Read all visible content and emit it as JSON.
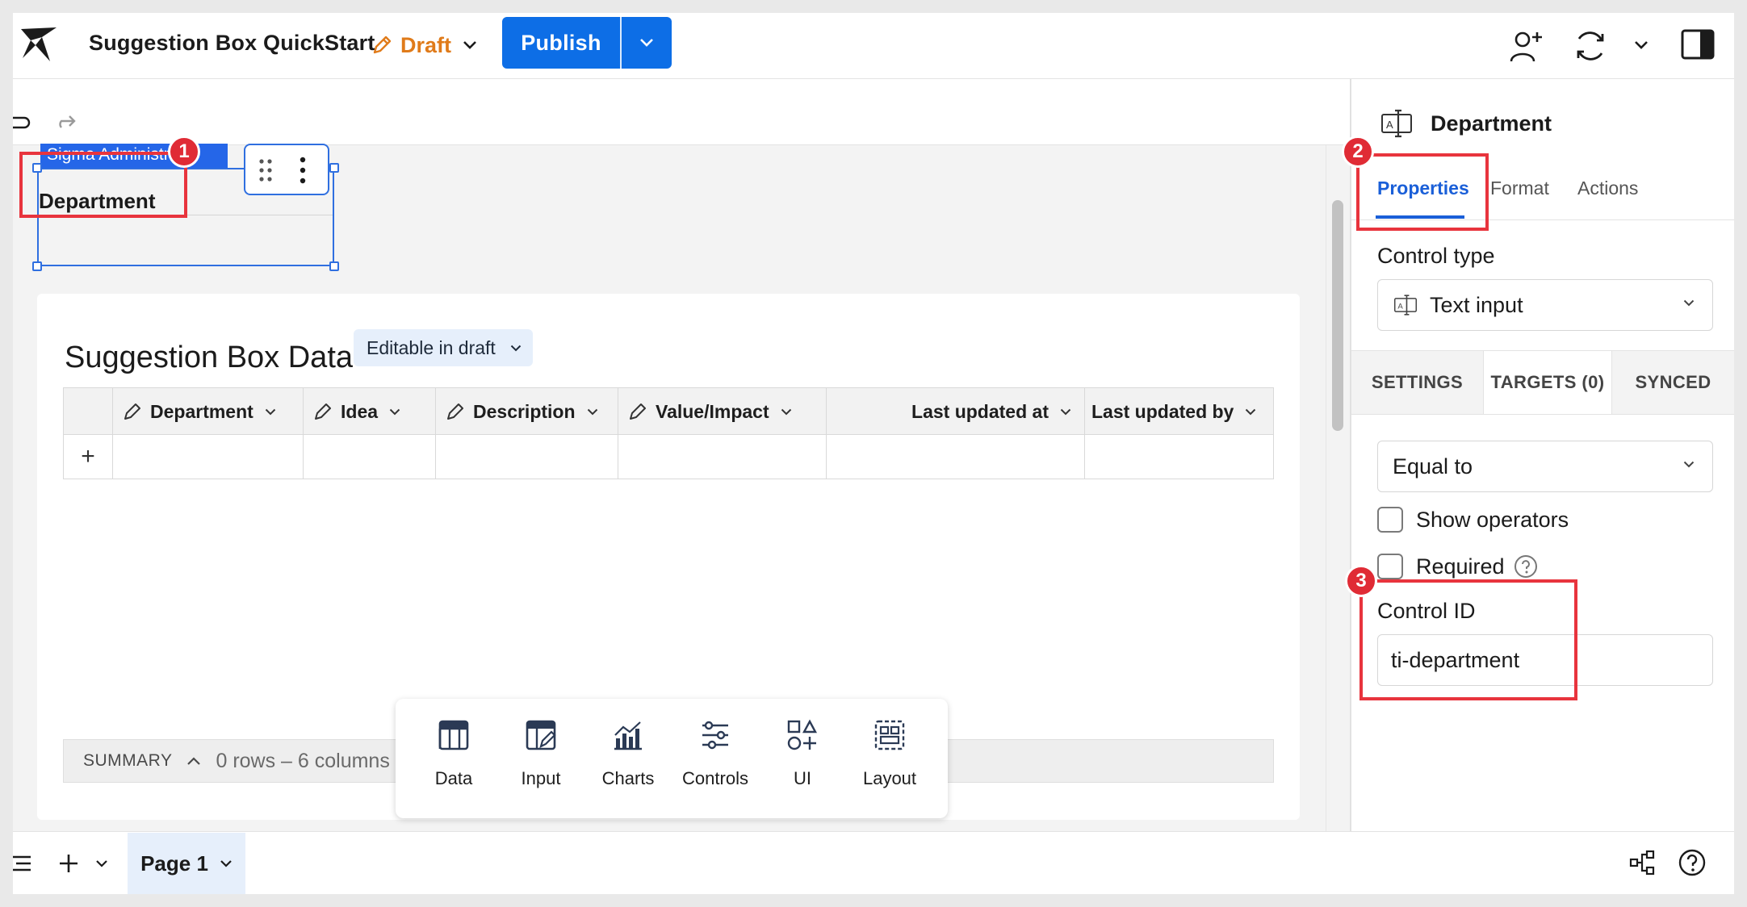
{
  "app": {
    "document_title": "Suggestion Box QuickStart",
    "status_label": "Draft",
    "publish_label": "Publish"
  },
  "canvas": {
    "user_tag": "Sigma Administrator",
    "control_label": "Department",
    "table": {
      "title": "Suggestion Box Data",
      "badge": "Editable in draft",
      "columns": [
        {
          "label": "Department",
          "editable": true
        },
        {
          "label": "Idea",
          "editable": true
        },
        {
          "label": "Description",
          "editable": true
        },
        {
          "label": "Value/Impact",
          "editable": true
        },
        {
          "label": "Last updated at",
          "editable": false
        },
        {
          "label": "Last updated by",
          "editable": false
        }
      ],
      "add_row_symbol": "+"
    },
    "summary": {
      "label": "SUMMARY",
      "count": "0 rows – 6 columns"
    },
    "toolbox": [
      {
        "label": "Data",
        "icon": "table-icon"
      },
      {
        "label": "Input",
        "icon": "input-table-icon"
      },
      {
        "label": "Charts",
        "icon": "chart-icon"
      },
      {
        "label": "Controls",
        "icon": "sliders-icon"
      },
      {
        "label": "UI",
        "icon": "shapes-icon"
      },
      {
        "label": "Layout",
        "icon": "layout-icon"
      }
    ]
  },
  "footer": {
    "page_tab": "Page 1"
  },
  "panel": {
    "title": "Department",
    "tabs": [
      "Properties",
      "Format",
      "Actions"
    ],
    "active_tab": "Properties",
    "control_type_label": "Control type",
    "control_type_value": "Text input",
    "subtabs": [
      "SETTINGS",
      "TARGETS (0)",
      "SYNCED"
    ],
    "operator_value": "Equal to",
    "show_operators_label": "Show operators",
    "required_label": "Required",
    "control_id_label": "Control ID",
    "control_id_value": "ti-department"
  },
  "annotations": [
    "1",
    "2",
    "3"
  ],
  "colors": {
    "accent": "#0d6ee6",
    "draft": "#e07b1a",
    "highlight": "#e8343d"
  }
}
